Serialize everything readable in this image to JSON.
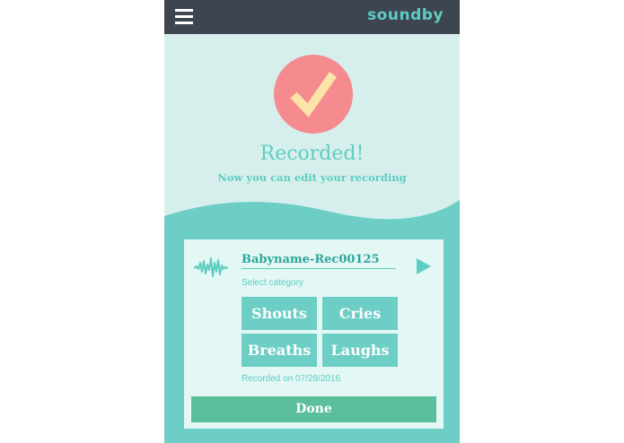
{
  "app": {
    "brand": "soundby"
  },
  "status": {
    "title": "Recorded!",
    "subtitle": "Now you can edit your recording"
  },
  "recording": {
    "name": "Babyname-Rec00125",
    "select_category_label": "Select category",
    "categories": [
      "Shouts",
      "Cries",
      "Breaths",
      "Laughs"
    ],
    "recorded_on": "Recorded on 07/28/2016"
  },
  "actions": {
    "done_label": "Done"
  },
  "colors": {
    "teal_accent": "#5ecdc1",
    "panel_teal": "#6ccec5",
    "coral_check": "#f58b8f",
    "check_mark": "#fce3a8",
    "header_dark": "#3d4551",
    "done_green": "#5bbf9b"
  },
  "icons": {
    "menu": "hamburger-menu-icon",
    "status": "checkmark-icon",
    "waveform": "waveform-icon",
    "play": "play-icon"
  }
}
